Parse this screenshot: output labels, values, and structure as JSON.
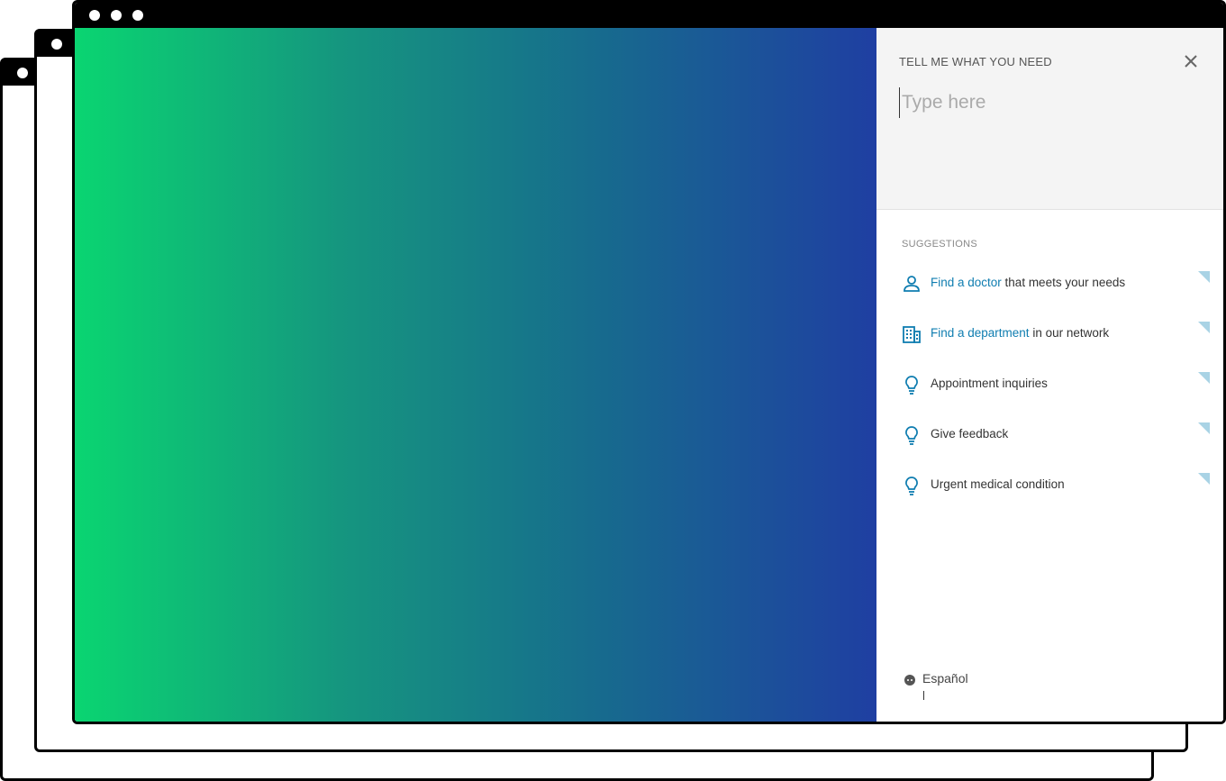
{
  "panel": {
    "title": "TELL ME WHAT YOU NEED",
    "search_placeholder": "Type here",
    "search_value": ""
  },
  "suggestions": {
    "title": "SUGGESTIONS",
    "items": [
      {
        "icon": "person-icon",
        "link": "Find a doctor",
        "text": " that meets your needs"
      },
      {
        "icon": "building-icon",
        "link": "Find a department",
        "text": " in our network"
      },
      {
        "icon": "lightbulb-icon",
        "link": "",
        "text": "Appointment inquiries"
      },
      {
        "icon": "lightbulb-icon",
        "link": "",
        "text": "Give feedback"
      },
      {
        "icon": "lightbulb-icon",
        "link": "",
        "text": "Urgent medical condition"
      }
    ]
  },
  "language": {
    "label": "Español"
  },
  "colors": {
    "accent": "#0f7db0",
    "gradient_start": "#0ad571",
    "gradient_end": "#1f3fa2",
    "corner": "#a9d3e5"
  }
}
